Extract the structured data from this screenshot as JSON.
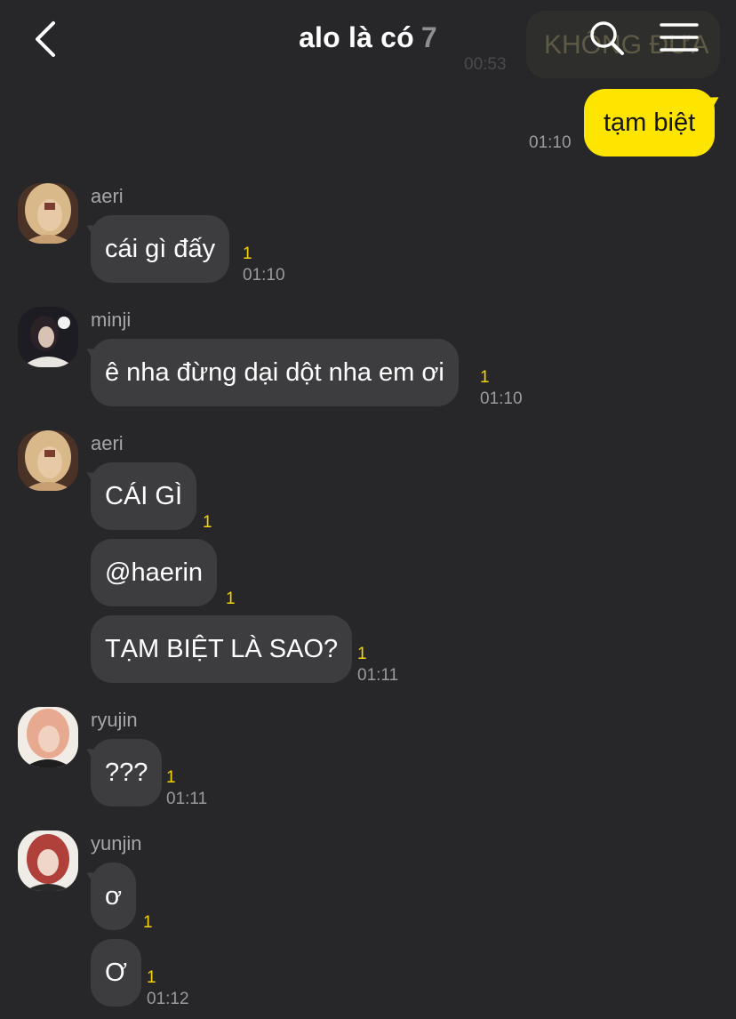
{
  "header": {
    "title": "alo là có",
    "member_count": "7",
    "back_icon": "chevron-left-icon",
    "search_icon": "search-icon",
    "menu_icon": "hamburger-menu-icon"
  },
  "ghost_message": {
    "text": "KHÔNG ĐƯA",
    "time": "00:53"
  },
  "outgoing": {
    "text": "tạm biệt",
    "time": "01:10"
  },
  "groups": [
    {
      "sender": "aeri",
      "messages": [
        {
          "text": "cái gì đấy",
          "unread": "1",
          "time": "01:10"
        }
      ]
    },
    {
      "sender": "minji",
      "messages": [
        {
          "text": "ê nha đừng dại dột nha em ơi",
          "unread": "1",
          "time": "01:10"
        }
      ]
    },
    {
      "sender": "aeri",
      "messages": [
        {
          "text": "CÁI GÌ",
          "unread": "1",
          "time": ""
        },
        {
          "text": "@haerin",
          "unread": "1",
          "time": ""
        },
        {
          "text": "TẠM BIỆT LÀ SAO?",
          "unread": "1",
          "time": "01:11"
        }
      ]
    },
    {
      "sender": "ryujin",
      "messages": [
        {
          "text": "???",
          "unread": "1",
          "time": "01:11"
        }
      ]
    },
    {
      "sender": "yunjin",
      "messages": [
        {
          "text": "ơ",
          "unread": "1",
          "time": ""
        },
        {
          "text": "Ơ",
          "unread": "1",
          "time": "01:12"
        }
      ]
    }
  ],
  "colors": {
    "background": "#27272a",
    "outgoing_bubble": "#fde500",
    "incoming_bubble": "#3d3d40",
    "unread_count": "#f5d400",
    "timestamp": "#9b9b9f"
  }
}
